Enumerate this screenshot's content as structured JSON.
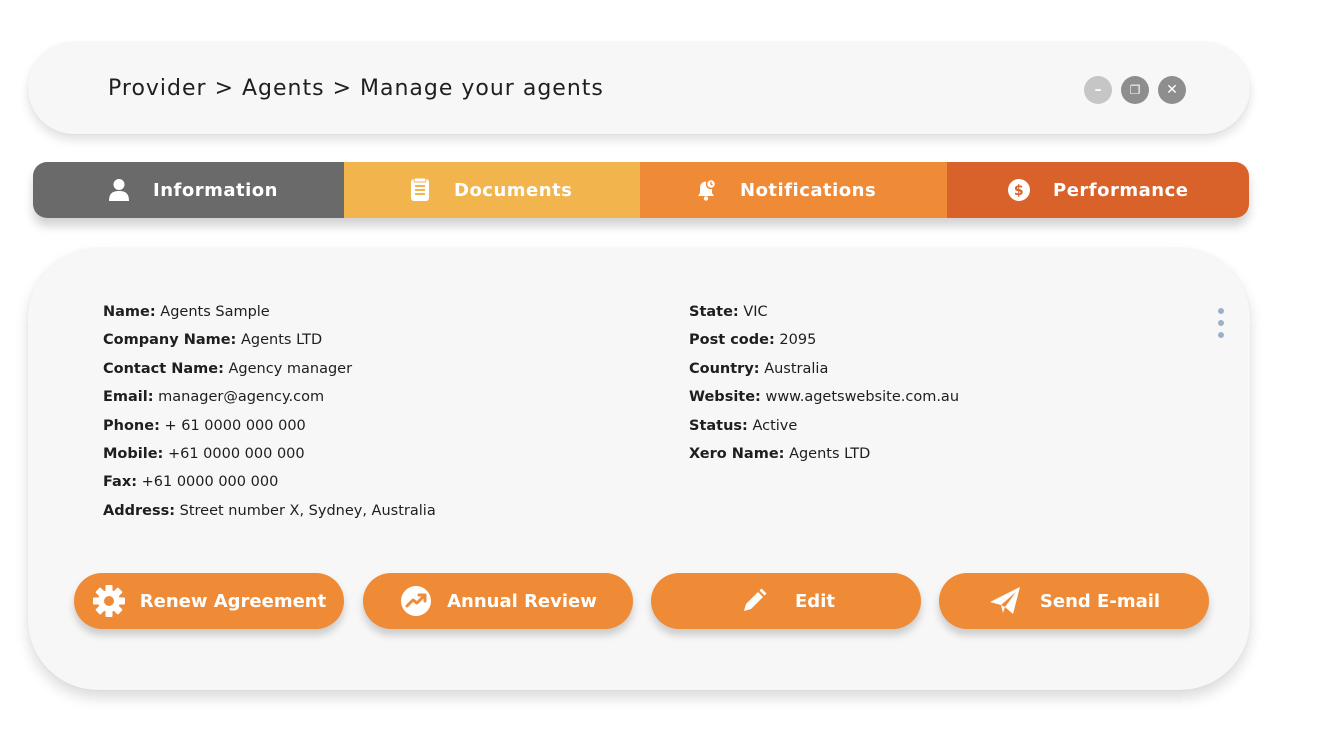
{
  "header": {
    "breadcrumb": "Provider > Agents > Manage your agents",
    "controls": [
      {
        "name": "minimize",
        "glyph": "–"
      },
      {
        "name": "restore",
        "glyph": "❐"
      },
      {
        "name": "close",
        "glyph": "✕"
      }
    ]
  },
  "tabs": [
    {
      "label": "Information",
      "icon": "person-icon",
      "color": "#6a6a6a"
    },
    {
      "label": "Documents",
      "icon": "document-icon",
      "color": "#f2b44d"
    },
    {
      "label": "Notifications",
      "icon": "bell-icon",
      "color": "#ef8a37"
    },
    {
      "label": "Performance",
      "icon": "dollar-coin-icon",
      "color": "#d9612a"
    }
  ],
  "details": {
    "left": [
      {
        "label": "Name:",
        "value": "Agents Sample"
      },
      {
        "label": "Company Name:",
        "value": "Agents LTD"
      },
      {
        "label": "Contact Name:",
        "value": "Agency manager"
      },
      {
        "label": "Email:",
        "value": "manager@agency.com"
      },
      {
        "label": "Phone:",
        "value": "+ 61 0000 000 000"
      },
      {
        "label": "Mobile:",
        "value": "+61 0000 000 000"
      },
      {
        "label": "Fax:",
        "value": "+61 0000 000 000"
      },
      {
        "label": "Address:",
        "value": "Street number X, Sydney, Australia"
      }
    ],
    "right": [
      {
        "label": "State:",
        "value": "VIC"
      },
      {
        "label": "Post code:",
        "value": "2095"
      },
      {
        "label": "Country:",
        "value": "Australia"
      },
      {
        "label": "Website:",
        "value": "www.agetswebsite.com.au"
      },
      {
        "label": "Status:",
        "value": "Active"
      },
      {
        "label": "Xero Name:",
        "value": "Agents LTD"
      }
    ]
  },
  "actions": [
    {
      "label": "Renew Agreement",
      "icon": "gear-icon"
    },
    {
      "label": "Annual Review",
      "icon": "trend-icon"
    },
    {
      "label": "Edit",
      "icon": "pencil-icon"
    },
    {
      "label": "Send E-mail",
      "icon": "paper-plane-icon"
    }
  ],
  "colors": {
    "accent": "#ef8a37",
    "accent_dark": "#d9612a",
    "accent_light": "#f2b44d",
    "neutral": "#6a6a6a",
    "kebab": "#9db0c9"
  }
}
